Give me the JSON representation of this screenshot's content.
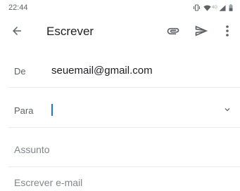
{
  "status_bar": {
    "time": "22:44",
    "network_label": "4G",
    "icons": [
      "vibrate-icon",
      "wifi-icon",
      "signal-icon",
      "battery-icon"
    ]
  },
  "toolbar": {
    "title": "Escrever",
    "icons": {
      "back": "arrow-back-icon",
      "attach": "attach-icon",
      "send": "send-icon",
      "more": "more-vert-icon"
    }
  },
  "compose": {
    "from_label": "De",
    "from_value": "seuemail@gmail.com",
    "to_label": "Para",
    "to_value": "",
    "subject_placeholder": "Assunto",
    "body_placeholder": "Escrever e-mail"
  },
  "colors": {
    "accent": "#1a73e8",
    "text_primary": "#202124",
    "text_secondary": "#5f6368",
    "divider": "#e8eaed"
  }
}
